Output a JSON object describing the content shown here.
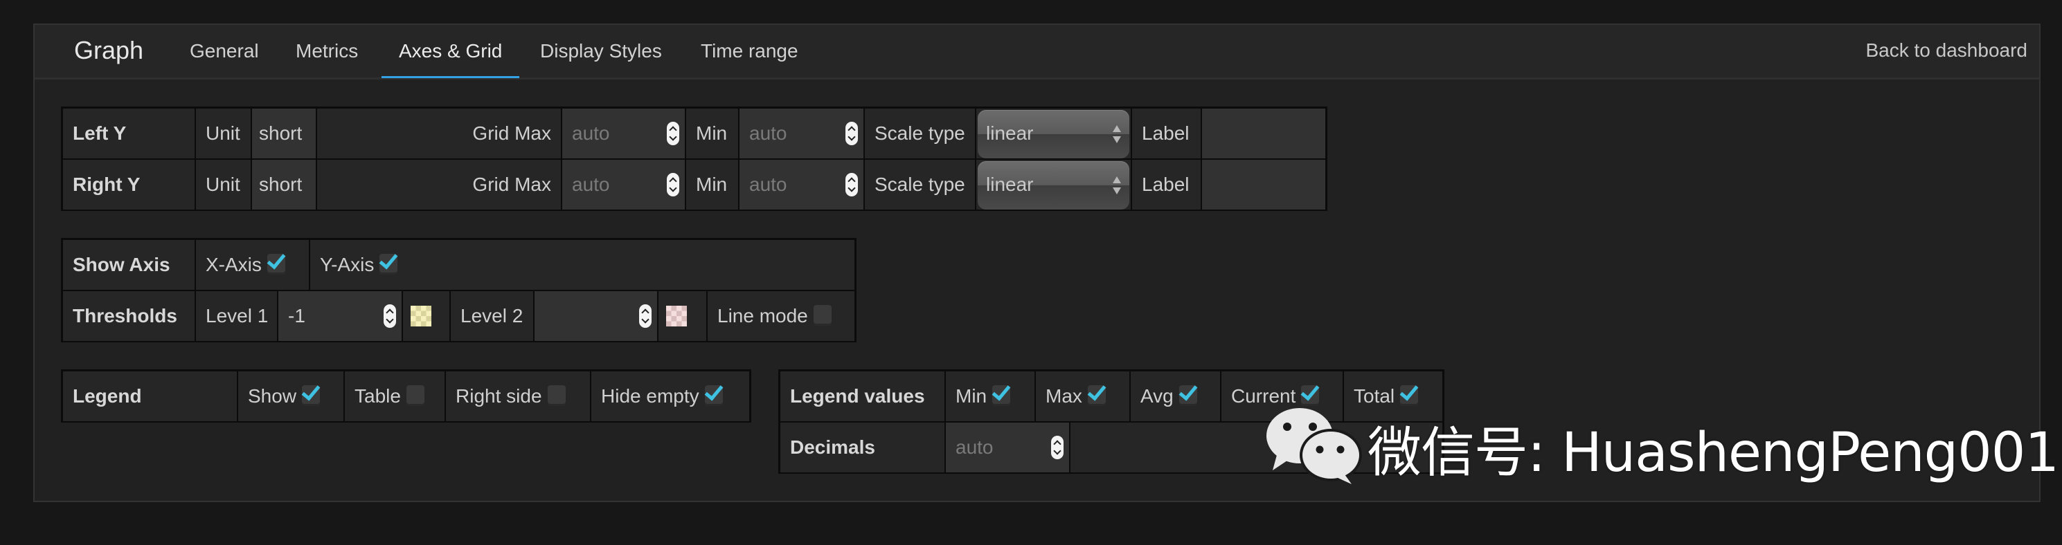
{
  "header": {
    "title": "Graph",
    "tabs": [
      {
        "label": "General",
        "active": false
      },
      {
        "label": "Metrics",
        "active": false
      },
      {
        "label": "Axes & Grid",
        "active": true
      },
      {
        "label": "Display Styles",
        "active": false
      },
      {
        "label": "Time range",
        "active": false
      }
    ],
    "back_link": "Back to dashboard",
    "accent_color": "#33a2e5"
  },
  "axes": {
    "rows": [
      {
        "name": "Left Y",
        "unit_label": "Unit",
        "unit_value": "short",
        "grid_max_label": "Grid Max",
        "grid_max_placeholder": "auto",
        "min_label": "Min",
        "min_placeholder": "auto",
        "scale_type_label": "Scale type",
        "scale_type_value": "linear",
        "label_label": "Label",
        "label_value": ""
      },
      {
        "name": "Right Y",
        "unit_label": "Unit",
        "unit_value": "short",
        "grid_max_label": "Grid Max",
        "grid_max_placeholder": "auto",
        "min_label": "Min",
        "min_placeholder": "auto",
        "scale_type_label": "Scale type",
        "scale_type_value": "linear",
        "label_label": "Label",
        "label_value": ""
      }
    ]
  },
  "show_axis": {
    "label": "Show Axis",
    "x_axis": {
      "label": "X-Axis",
      "checked": true
    },
    "y_axis": {
      "label": "Y-Axis",
      "checked": true
    }
  },
  "thresholds": {
    "label": "Thresholds",
    "level1_label": "Level 1",
    "level1_value": "-1",
    "level1_color": "#f6f1bc",
    "level2_label": "Level 2",
    "level2_value": "",
    "level2_color": "#f5dede",
    "line_mode_label": "Line mode",
    "line_mode_checked": false
  },
  "legend": {
    "label": "Legend",
    "options": [
      {
        "label": "Show",
        "checked": true
      },
      {
        "label": "Table",
        "checked": false
      },
      {
        "label": "Right side",
        "checked": false
      },
      {
        "label": "Hide empty",
        "checked": true
      }
    ]
  },
  "legend_values": {
    "label": "Legend values",
    "options": [
      {
        "label": "Min",
        "checked": true
      },
      {
        "label": "Max",
        "checked": true
      },
      {
        "label": "Avg",
        "checked": true
      },
      {
        "label": "Current",
        "checked": true
      },
      {
        "label": "Total",
        "checked": true
      }
    ],
    "decimals_label": "Decimals",
    "decimals_placeholder": "auto"
  },
  "watermark": {
    "icon": "wechat-icon",
    "text": "微信号: HuashengPeng001"
  },
  "checkbox_color": "#3fc1e2"
}
